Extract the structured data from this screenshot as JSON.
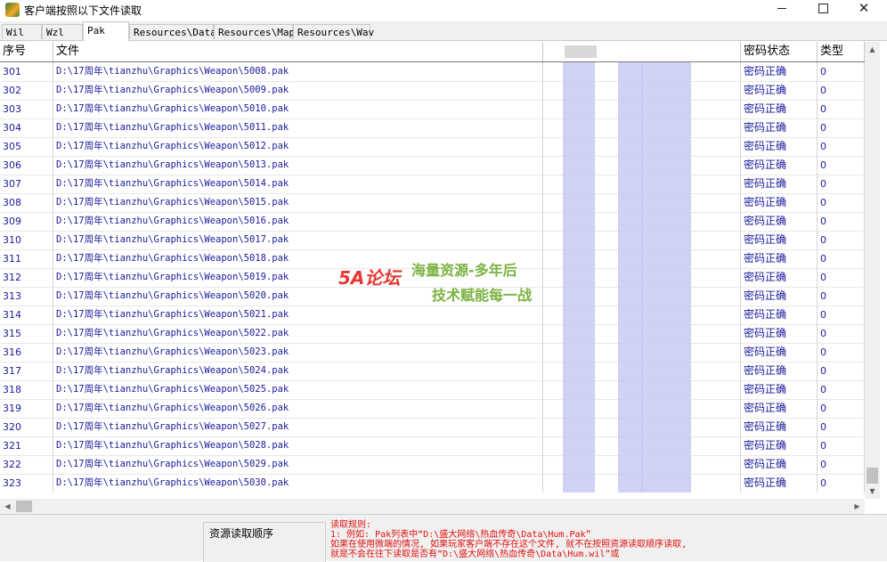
{
  "window": {
    "title": "客户端按照以下文件读取",
    "minimize_glyph": "",
    "close_glyph": "✕"
  },
  "tabs": [
    {
      "label": "Wil"
    },
    {
      "label": "Wzl"
    },
    {
      "label": "Pak",
      "active": true
    },
    {
      "label": "Resources\\Data"
    },
    {
      "label": "Resources\\Map"
    },
    {
      "label": "Resources\\Wav"
    }
  ],
  "table": {
    "headers": {
      "no": "序号",
      "file": "文件",
      "blurred": "",
      "password_status": "密码状态",
      "type": "类型"
    },
    "rows": [
      {
        "no": "301",
        "file": "D:\\17周年\\tianzhu\\Graphics\\Weapon\\5008.pak",
        "status": "密码正确",
        "type": "0"
      },
      {
        "no": "302",
        "file": "D:\\17周年\\tianzhu\\Graphics\\Weapon\\5009.pak",
        "status": "密码正确",
        "type": "0"
      },
      {
        "no": "303",
        "file": "D:\\17周年\\tianzhu\\Graphics\\Weapon\\5010.pak",
        "status": "密码正确",
        "type": "0"
      },
      {
        "no": "304",
        "file": "D:\\17周年\\tianzhu\\Graphics\\Weapon\\5011.pak",
        "status": "密码正确",
        "type": "0"
      },
      {
        "no": "305",
        "file": "D:\\17周年\\tianzhu\\Graphics\\Weapon\\5012.pak",
        "status": "密码正确",
        "type": "0"
      },
      {
        "no": "306",
        "file": "D:\\17周年\\tianzhu\\Graphics\\Weapon\\5013.pak",
        "status": "密码正确",
        "type": "0"
      },
      {
        "no": "307",
        "file": "D:\\17周年\\tianzhu\\Graphics\\Weapon\\5014.pak",
        "status": "密码正确",
        "type": "0"
      },
      {
        "no": "308",
        "file": "D:\\17周年\\tianzhu\\Graphics\\Weapon\\5015.pak",
        "status": "密码正确",
        "type": "0"
      },
      {
        "no": "309",
        "file": "D:\\17周年\\tianzhu\\Graphics\\Weapon\\5016.pak",
        "status": "密码正确",
        "type": "0"
      },
      {
        "no": "310",
        "file": "D:\\17周年\\tianzhu\\Graphics\\Weapon\\5017.pak",
        "status": "密码正确",
        "type": "0"
      },
      {
        "no": "311",
        "file": "D:\\17周年\\tianzhu\\Graphics\\Weapon\\5018.pak",
        "status": "密码正确",
        "type": "0"
      },
      {
        "no": "312",
        "file": "D:\\17周年\\tianzhu\\Graphics\\Weapon\\5019.pak",
        "status": "密码正确",
        "type": "0"
      },
      {
        "no": "313",
        "file": "D:\\17周年\\tianzhu\\Graphics\\Weapon\\5020.pak",
        "status": "密码正确",
        "type": "0"
      },
      {
        "no": "314",
        "file": "D:\\17周年\\tianzhu\\Graphics\\Weapon\\5021.pak",
        "status": "密码正确",
        "type": "0"
      },
      {
        "no": "315",
        "file": "D:\\17周年\\tianzhu\\Graphics\\Weapon\\5022.pak",
        "status": "密码正确",
        "type": "0"
      },
      {
        "no": "316",
        "file": "D:\\17周年\\tianzhu\\Graphics\\Weapon\\5023.pak",
        "status": "密码正确",
        "type": "0"
      },
      {
        "no": "317",
        "file": "D:\\17周年\\tianzhu\\Graphics\\Weapon\\5024.pak",
        "status": "密码正确",
        "type": "0"
      },
      {
        "no": "318",
        "file": "D:\\17周年\\tianzhu\\Graphics\\Weapon\\5025.pak",
        "status": "密码正确",
        "type": "0"
      },
      {
        "no": "319",
        "file": "D:\\17周年\\tianzhu\\Graphics\\Weapon\\5026.pak",
        "status": "密码正确",
        "type": "0"
      },
      {
        "no": "320",
        "file": "D:\\17周年\\tianzhu\\Graphics\\Weapon\\5027.pak",
        "status": "密码正确",
        "type": "0"
      },
      {
        "no": "321",
        "file": "D:\\17周年\\tianzhu\\Graphics\\Weapon\\5028.pak",
        "status": "密码正确",
        "type": "0"
      },
      {
        "no": "322",
        "file": "D:\\17周年\\tianzhu\\Graphics\\Weapon\\5029.pak",
        "status": "密码正确",
        "type": "0"
      },
      {
        "no": "323",
        "file": "D:\\17周年\\tianzhu\\Graphics\\Weapon\\5030.pak",
        "status": "密码正确",
        "type": "0"
      }
    ]
  },
  "bottom": {
    "order_label": "资源读取顺序",
    "rules_title": "读取规则:",
    "rules_lines": [
      "1: 例如: Pak列表中“D:\\盛大网络\\热血传奇\\Data\\Hum.Pak”",
      "   如果在使用微端的情况, 如果玩家客户端不存在这个文件, 就不在按照资源读取顺序读取,",
      "   就是不会在往下读取是否有“D:\\盛大网络\\热血传奇\\Data\\Hum.wil”或"
    ]
  },
  "watermark": {
    "logo": "5A论坛",
    "line1": "海量资源-多年后",
    "line2": "技术赋能每一战"
  },
  "colors": {
    "text_blue": "#1a1a9a",
    "rules_red": "#e01010",
    "blur_lavender": "#c7c9f3"
  }
}
